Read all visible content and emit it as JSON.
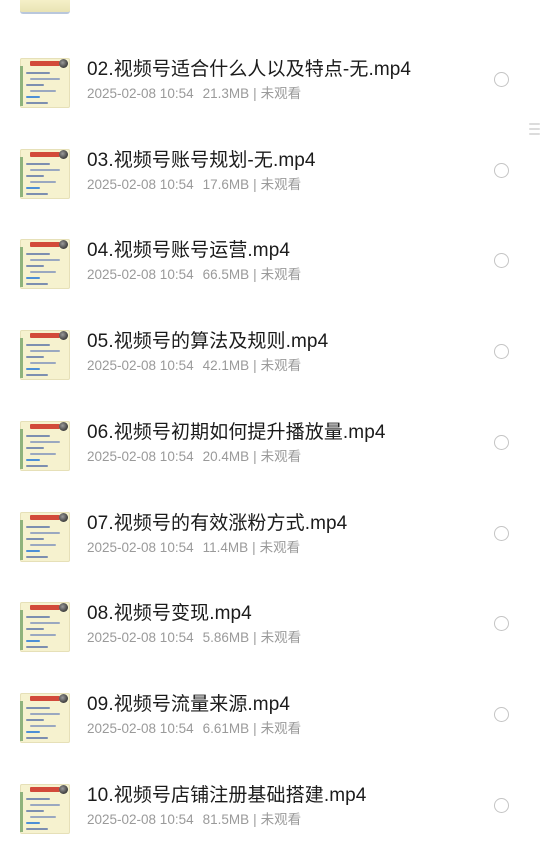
{
  "files": [
    {
      "name": "02.视频号适合什么人以及特点-无.mp4",
      "date": "2025-02-08 10:54",
      "size": "21.3MB",
      "status": "未观看"
    },
    {
      "name": "03.视频号账号规划-无.mp4",
      "date": "2025-02-08 10:54",
      "size": "17.6MB",
      "status": "未观看"
    },
    {
      "name": "04.视频号账号运营.mp4",
      "date": "2025-02-08 10:54",
      "size": "66.5MB",
      "status": "未观看"
    },
    {
      "name": "05.视频号的算法及规则.mp4",
      "date": "2025-02-08 10:54",
      "size": "42.1MB",
      "status": "未观看"
    },
    {
      "name": "06.视频号初期如何提升播放量.mp4",
      "date": "2025-02-08 10:54",
      "size": "20.4MB",
      "status": "未观看"
    },
    {
      "name": "07.视频号的有效涨粉方式.mp4",
      "date": "2025-02-08 10:54",
      "size": "11.4MB",
      "status": "未观看"
    },
    {
      "name": "08.视频号变现.mp4",
      "date": "2025-02-08 10:54",
      "size": "5.86MB",
      "status": "未观看"
    },
    {
      "name": "09.视频号流量来源.mp4",
      "date": "2025-02-08 10:54",
      "size": "6.61MB",
      "status": "未观看"
    },
    {
      "name": "10.视频号店铺注册基础搭建.mp4",
      "date": "2025-02-08 10:54",
      "size": "81.5MB",
      "status": "未观看"
    }
  ],
  "separator": "|",
  "icons": {
    "thumbnail": "video-thumbnail-icon",
    "select": "radio-circle-icon",
    "scroll": "drag-handle-icon"
  },
  "colors": {
    "title": "#1b1b1b",
    "meta": "#9a9a9a",
    "radio_border": "#c4c4c4",
    "background": "#ffffff"
  }
}
